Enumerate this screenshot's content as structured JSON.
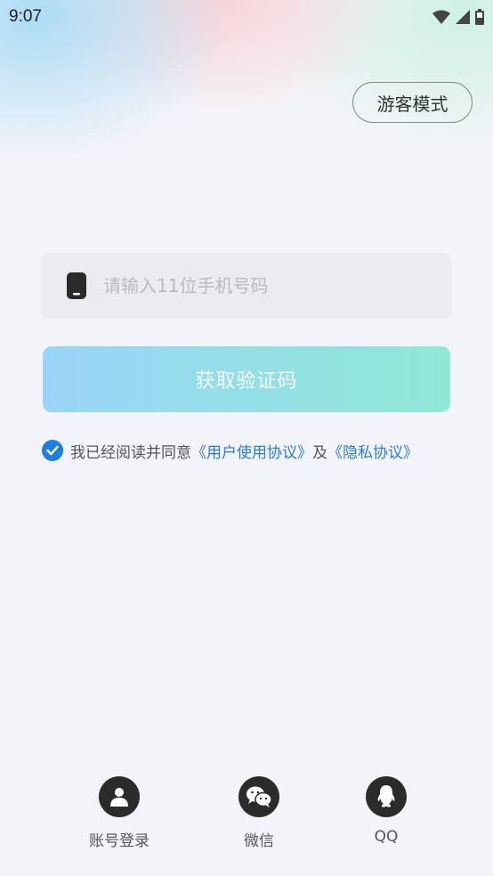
{
  "status_bar": {
    "time": "9:07",
    "icons": [
      "wifi-icon",
      "signal-icon",
      "battery-icon"
    ]
  },
  "header": {
    "guest_mode_label": "游客模式"
  },
  "phone_input": {
    "placeholder": "请输入11位手机号码",
    "value": "",
    "icon": "phone-icon"
  },
  "get_code_button": {
    "label": "获取验证码"
  },
  "agreement": {
    "checked": true,
    "prefix": "我已经阅读并同意",
    "user_agreement": "《用户使用协议》",
    "conjunction": "及",
    "privacy_policy": "《隐私协议》"
  },
  "alt_logins": [
    {
      "label": "账号登录",
      "icon": "user-icon"
    },
    {
      "label": "微信",
      "icon": "wechat-icon"
    },
    {
      "label": "QQ",
      "icon": "qq-icon"
    }
  ],
  "colors": {
    "accent_blue": "#1f7ee0",
    "link_blue": "#2b7bd8",
    "button_gradient_start": "#9ad5f8",
    "button_gradient_end": "#8fe9d6",
    "icon_circle": "#2b2b2b"
  }
}
